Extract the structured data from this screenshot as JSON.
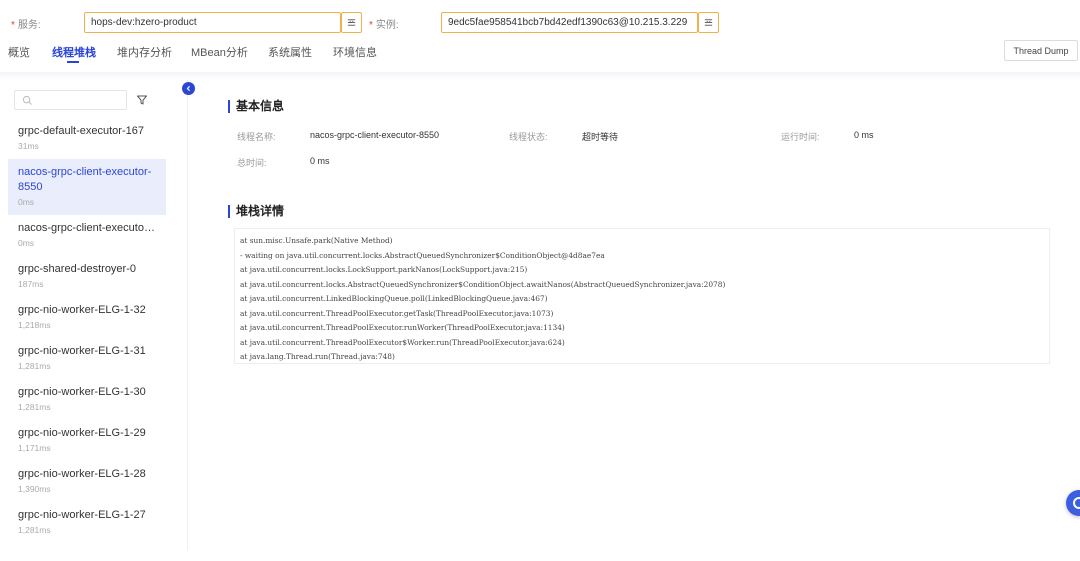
{
  "filters": {
    "service_label": "服务:",
    "service_value": "hops-dev:hzero-product",
    "instance_label": "实例:",
    "instance_value": "9edc5fae958541bcb7bd42edf1390c63@10.215.3.229",
    "required_mark": "*"
  },
  "tabs": [
    {
      "label": "概览",
      "active": false
    },
    {
      "label": "线程堆栈",
      "active": true
    },
    {
      "label": "堆内存分析",
      "active": false
    },
    {
      "label": "MBean分析",
      "active": false
    },
    {
      "label": "系统属性",
      "active": false
    },
    {
      "label": "环境信息",
      "active": false
    }
  ],
  "toolbar": {
    "thread_dump_label": "Thread Dump"
  },
  "sidebar": {
    "search_icon": "search-icon",
    "filter_icon": "filter-icon",
    "threads": [
      {
        "name": "grpc-default-executor-167",
        "time": "31ms"
      },
      {
        "name": "nacos-grpc-client-executor-8550",
        "time": "0ms",
        "selected": true
      },
      {
        "name": "nacos-grpc-client-executor...",
        "time": "0ms"
      },
      {
        "name": "grpc-shared-destroyer-0",
        "time": "187ms"
      },
      {
        "name": "grpc-nio-worker-ELG-1-32",
        "time": "1,218ms"
      },
      {
        "name": "grpc-nio-worker-ELG-1-31",
        "time": "1,281ms"
      },
      {
        "name": "grpc-nio-worker-ELG-1-30",
        "time": "1,281ms"
      },
      {
        "name": "grpc-nio-worker-ELG-1-29",
        "time": "1,171ms"
      },
      {
        "name": "grpc-nio-worker-ELG-1-28",
        "time": "1,390ms"
      },
      {
        "name": "grpc-nio-worker-ELG-1-27",
        "time": "1,281ms"
      }
    ]
  },
  "basic_info": {
    "title": "基本信息",
    "thread_name_label": "线程名称:",
    "thread_name_value": "nacos-grpc-client-executor-8550",
    "thread_state_label": "线程状态:",
    "thread_state_value": "超时等待",
    "run_time_label": "运行时间:",
    "run_time_value": "0 ms",
    "total_time_label": "总时间:",
    "total_time_value": "0 ms"
  },
  "stack_details": {
    "title": "堆栈详情",
    "lines": [
      "at sun.misc.Unsafe.park(Native Method)",
      "- waiting on java.util.concurrent.locks.AbstractQueuedSynchronizer$ConditionObject@4d8ae7ea",
      "at java.util.concurrent.locks.LockSupport.parkNanos(LockSupport.java:215)",
      "at java.util.concurrent.locks.AbstractQueuedSynchronizer$ConditionObject.awaitNanos(AbstractQueuedSynchronizer.java:2078)",
      "at java.util.concurrent.LinkedBlockingQueue.poll(LinkedBlockingQueue.java:467)",
      "at java.util.concurrent.ThreadPoolExecutor.getTask(ThreadPoolExecutor.java:1073)",
      "at java.util.concurrent.ThreadPoolExecutor.runWorker(ThreadPoolExecutor.java:1134)",
      "at java.util.concurrent.ThreadPoolExecutor$Worker.run(ThreadPoolExecutor.java:624)",
      "at java.lang.Thread.run(Thread.java:748)"
    ]
  },
  "colors": {
    "accent": "#2b45d6",
    "field_border": "#f0b14a",
    "required": "#e4393c"
  }
}
